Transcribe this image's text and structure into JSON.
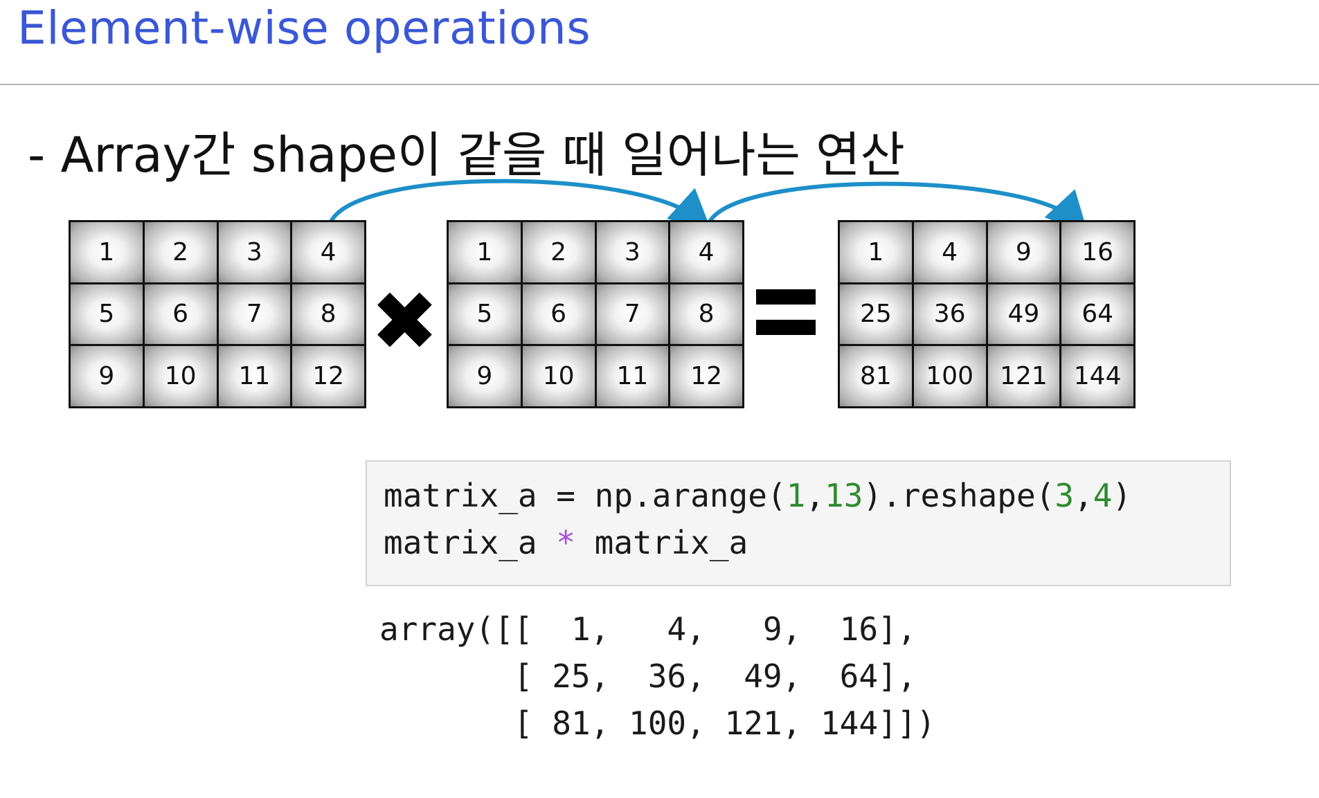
{
  "title": "Element-wise operations",
  "subtitle": "- Array간 shape이 같을 때 일어나는 연산",
  "matrices": {
    "left": [
      "1",
      "2",
      "3",
      "4",
      "5",
      "6",
      "7",
      "8",
      "9",
      "10",
      "11",
      "12"
    ],
    "middle": [
      "1",
      "2",
      "3",
      "4",
      "5",
      "6",
      "7",
      "8",
      "9",
      "10",
      "11",
      "12"
    ],
    "result": [
      "1",
      "4",
      "9",
      "16",
      "25",
      "36",
      "49",
      "64",
      "81",
      "100",
      "121",
      "144"
    ]
  },
  "operators": {
    "multiply": "✖",
    "multiply_icon": "multiply-icon",
    "equals_icon": "equals-icon"
  },
  "code": {
    "line1": {
      "a": "matrix_a = np.arange(",
      "n1": "1",
      "c1": ",",
      "n2": "13",
      "b": ").reshape(",
      "n3": "3",
      "c2": ",",
      "n4": "4",
      "e": ")"
    },
    "line2": {
      "a": "matrix_a ",
      "star": "*",
      "b": " matrix_a"
    }
  },
  "output": {
    "line1": "array([[  1,   4,   9,  16],",
    "line2": "       [ 25,  36,  49,  64],",
    "line3": "       [ 81, 100, 121, 144]])"
  },
  "colors": {
    "title": "#3a57d6",
    "arrow": "#1e8fc8",
    "code_number": "#2e8b2e",
    "code_operator": "#a64fd6"
  }
}
